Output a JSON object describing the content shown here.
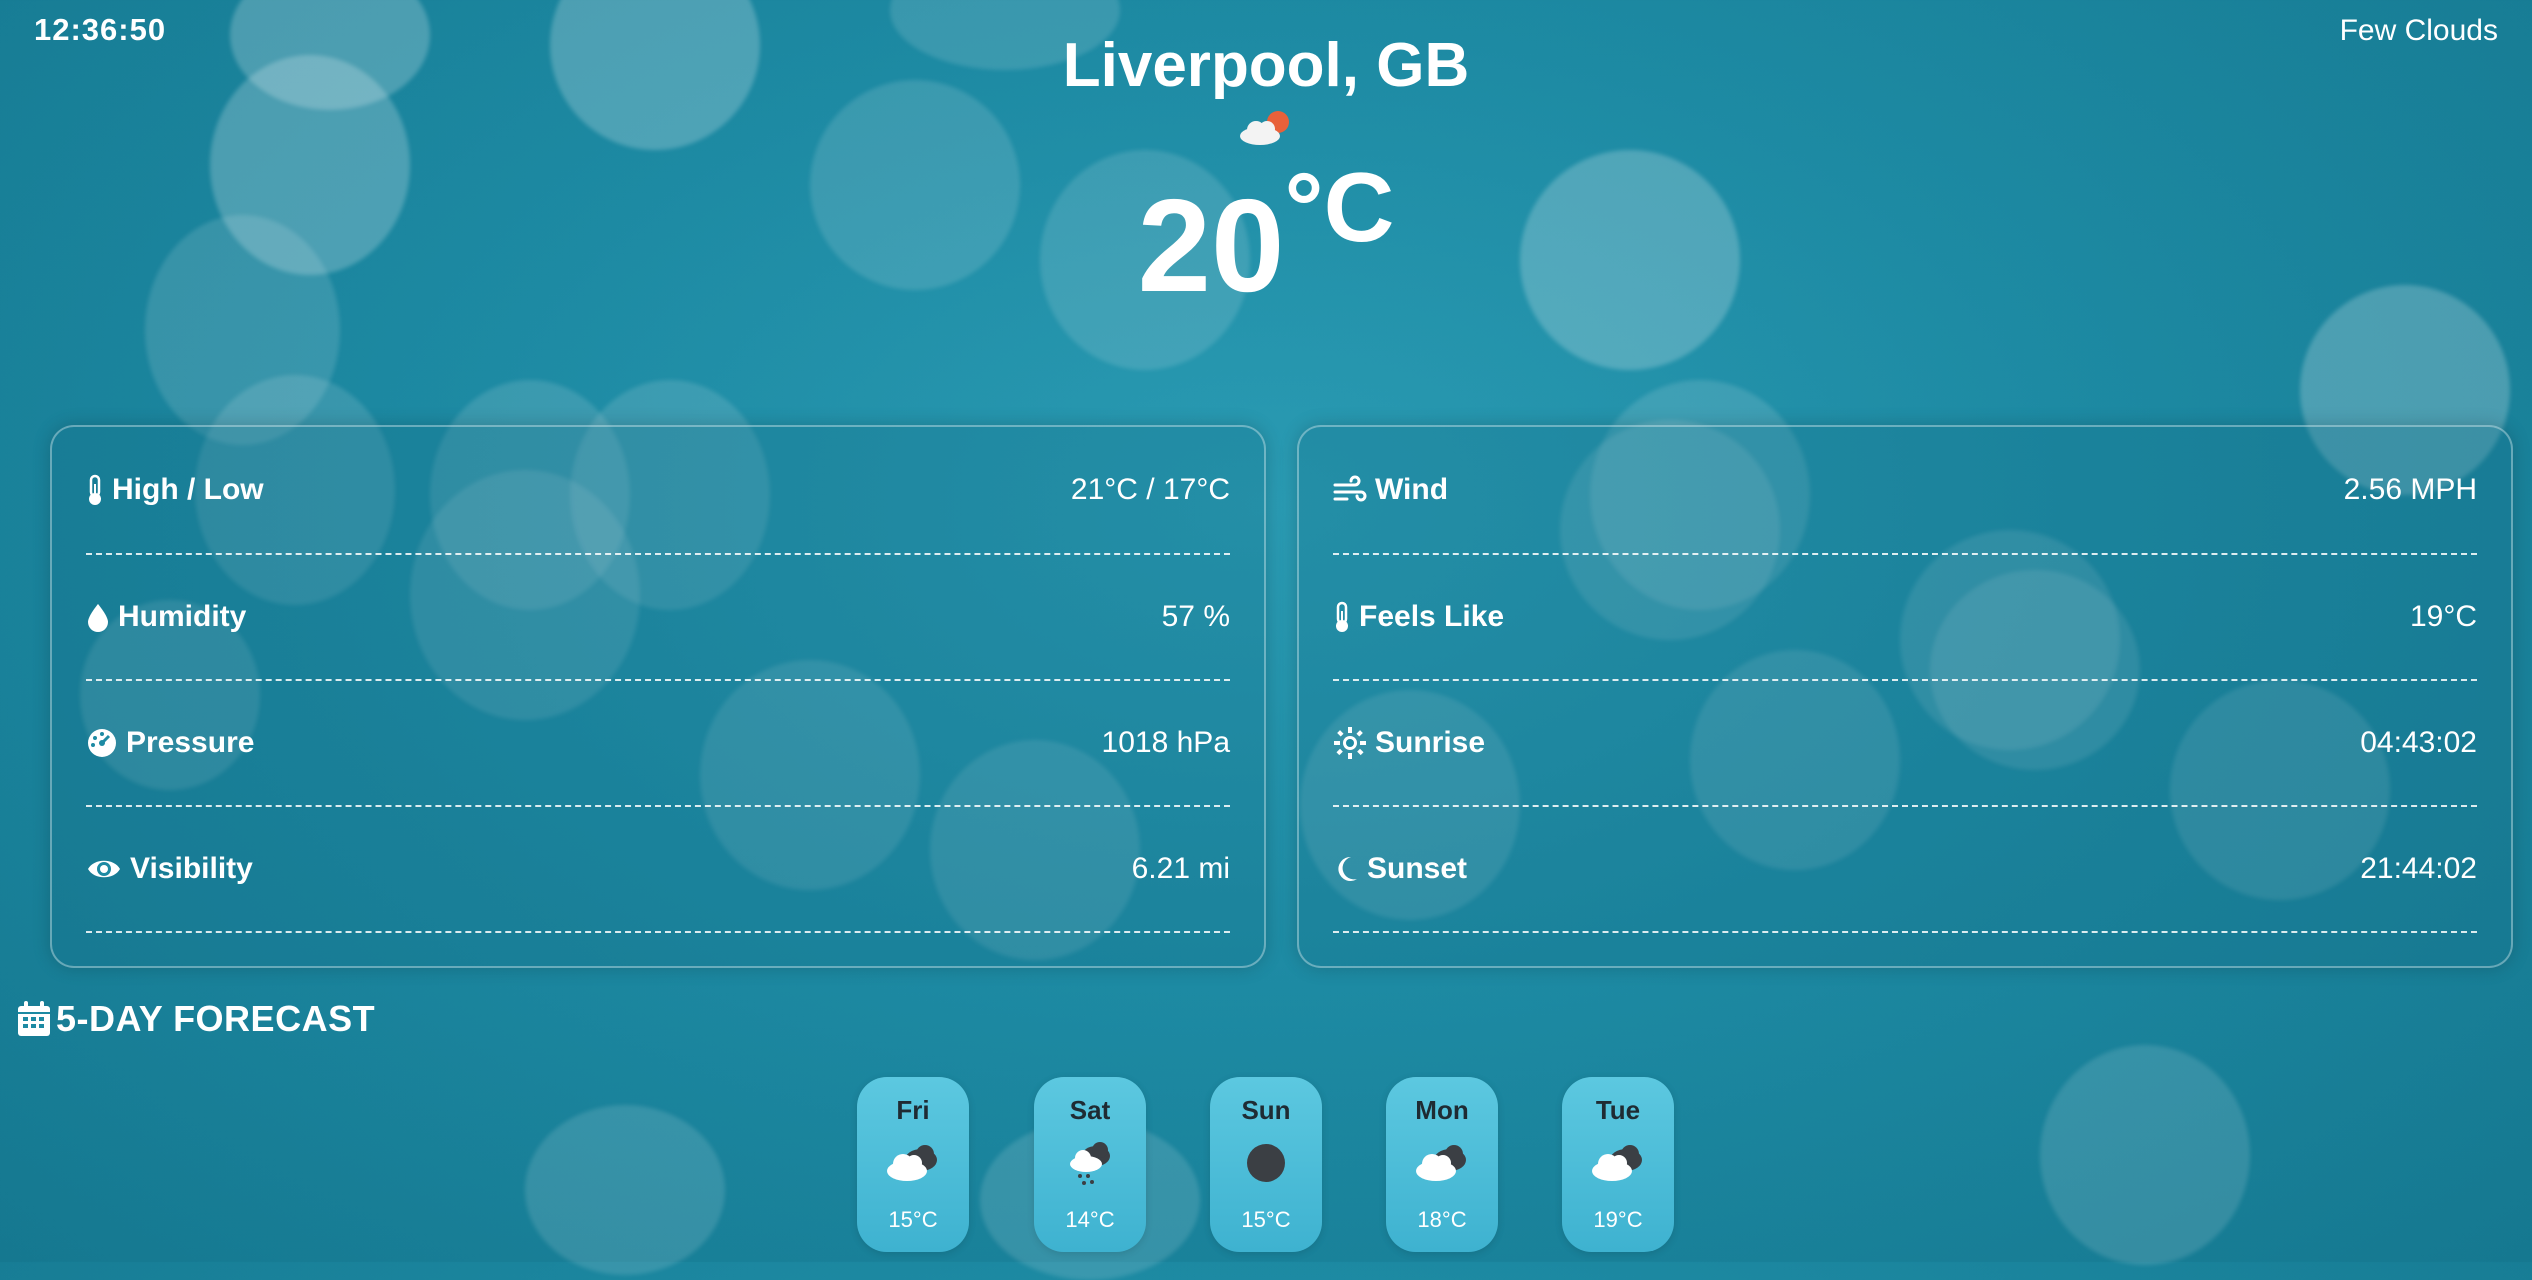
{
  "time": "12:36:50",
  "condition": "Few Clouds",
  "location": "Liverpool, GB",
  "current": {
    "temp": "20",
    "unit": "°C",
    "icon": "few-clouds-day-icon"
  },
  "details_left": [
    {
      "label": "High / Low",
      "value": "21°C / 17°C",
      "icon": "thermometer-icon"
    },
    {
      "label": "Humidity",
      "value": "57 %",
      "icon": "droplet-icon"
    },
    {
      "label": "Pressure",
      "value": "1018 hPa",
      "icon": "gauge-icon"
    },
    {
      "label": "Visibility",
      "value": "6.21 mi",
      "icon": "eye-icon"
    }
  ],
  "details_right": [
    {
      "label": "Wind",
      "value": "2.56 MPH",
      "icon": "wind-icon"
    },
    {
      "label": "Feels Like",
      "value": "19°C",
      "icon": "thermometer-icon"
    },
    {
      "label": "Sunrise",
      "value": "04:43:02",
      "icon": "sun-icon"
    },
    {
      "label": "Sunset",
      "value": "21:44:02",
      "icon": "moon-icon"
    }
  ],
  "forecast_title": "5-DAY FORECAST",
  "forecast": [
    {
      "day": "Fri",
      "temp": "15°C",
      "icon": "broken-clouds-icon"
    },
    {
      "day": "Sat",
      "temp": "14°C",
      "icon": "rain-cloud-icon"
    },
    {
      "day": "Sun",
      "temp": "15°C",
      "icon": "dark-circle-icon"
    },
    {
      "day": "Mon",
      "temp": "18°C",
      "icon": "broken-clouds-icon"
    },
    {
      "day": "Tue",
      "temp": "19°C",
      "icon": "broken-clouds-icon"
    }
  ],
  "colors": {
    "background": "#1d8aa3",
    "card_bg": "#5cc8e0",
    "sun": "#e8613a"
  }
}
